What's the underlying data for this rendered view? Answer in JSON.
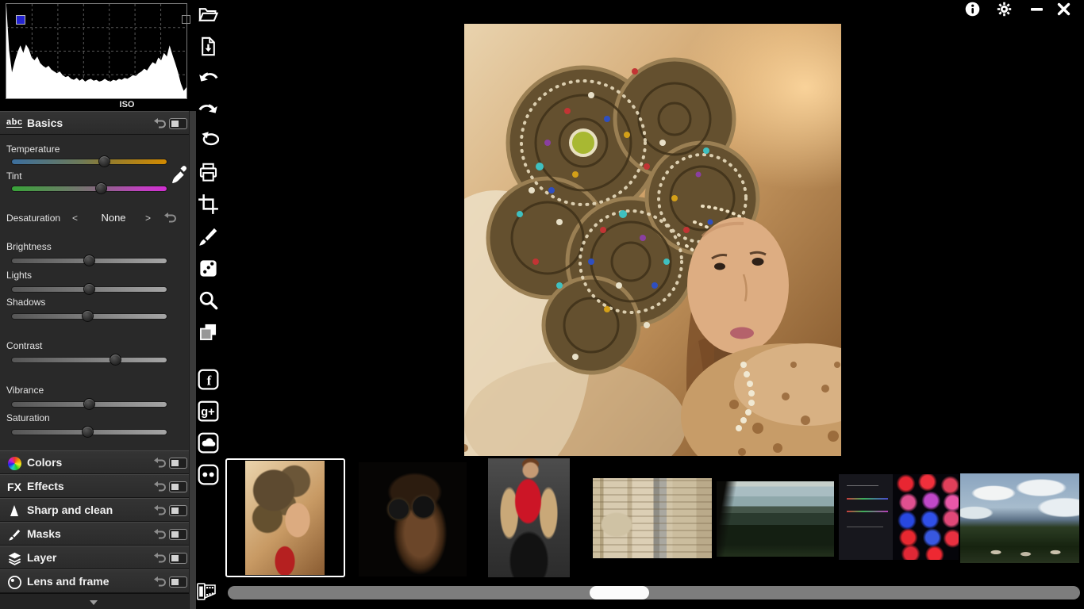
{
  "histogram": {
    "label": "ISO",
    "values": [
      100,
      52,
      28,
      40,
      50,
      57,
      49,
      58,
      53,
      44,
      41,
      45,
      38,
      35,
      33,
      35,
      31,
      29,
      27,
      29,
      25,
      23,
      24,
      21,
      20,
      22,
      19,
      21,
      18,
      20,
      21,
      19,
      20,
      18,
      19,
      21,
      19,
      18,
      20,
      19,
      21,
      20,
      22,
      21,
      23,
      25,
      24,
      27,
      29,
      32,
      30,
      35,
      39,
      37,
      44,
      41,
      49,
      45,
      57,
      47,
      38,
      28,
      16,
      8,
      12
    ],
    "grid_vertical_lines": 6,
    "grid_horizontal_lines": 3,
    "channel_indicator_color": "#2323d0"
  },
  "basics": {
    "icon_label": "abc",
    "title": "Basics",
    "temperature": {
      "label": "Temperature",
      "value": 60,
      "gradient_left": "#3c6f9e",
      "gradient_right": "#d28a00"
    },
    "tint": {
      "label": "Tint",
      "value": 58,
      "gradient_left": "#38a438",
      "gradient_right": "#d02fd0"
    },
    "desaturation": {
      "label": "Desaturation",
      "prev": "<",
      "value": "None",
      "next": ">"
    },
    "sliders": [
      {
        "label": "Brightness",
        "value": 50
      },
      {
        "label": "Lights",
        "value": 50
      },
      {
        "label": "Shadows",
        "value": 49
      },
      {
        "label": "Contrast",
        "value": 67
      },
      {
        "label": "Vibrance",
        "value": 50
      },
      {
        "label": "Saturation",
        "value": 49
      }
    ]
  },
  "sections": [
    {
      "label": "Colors",
      "icon": "color-wheel-icon"
    },
    {
      "label": "Effects",
      "icon": "fx-icon"
    },
    {
      "label": "Sharp and clean",
      "icon": "sharpen-triangle-icon"
    },
    {
      "label": "Masks",
      "icon": "brush-icon"
    },
    {
      "label": "Layer",
      "icon": "layers-icon"
    },
    {
      "label": "Lens and frame",
      "icon": "lens-icon"
    }
  ],
  "toolbar": {
    "icons": [
      "open-folder",
      "export-file",
      "undo",
      "redo",
      "revert",
      "print",
      "crop",
      "brush",
      "random-dice",
      "zoom",
      "compare-copies",
      "facebook",
      "google-plus",
      "onedrive-cloud",
      "flickr"
    ],
    "bottom_icon": "film-roll"
  },
  "window_controls": {
    "icons": [
      "info",
      "settings",
      "minimize",
      "close"
    ]
  },
  "filmstrip": {
    "selected_index": 0,
    "thumbnails": [
      {
        "name": "woman in beaded headdress (current photo)",
        "selected": true
      },
      {
        "name": "man wearing dark goggles",
        "selected": false
      },
      {
        "name": "woman in red top and fur jacket",
        "selected": false
      },
      {
        "name": "carved stone facade with elephant sculpture",
        "selected": false
      },
      {
        "name": "hill landscape at dusk",
        "selected": false
      },
      {
        "name": "tablet showing photo editor with glowing dots",
        "selected": false
      },
      {
        "name": "mountain landscape with clouds",
        "selected": false
      }
    ]
  },
  "scrollbar": {
    "track_color": "#7d7d7d",
    "thumb_color": "#fbfbfb"
  },
  "colors": {
    "panel_bg": "#292929",
    "canvas_bg": "#000000"
  }
}
